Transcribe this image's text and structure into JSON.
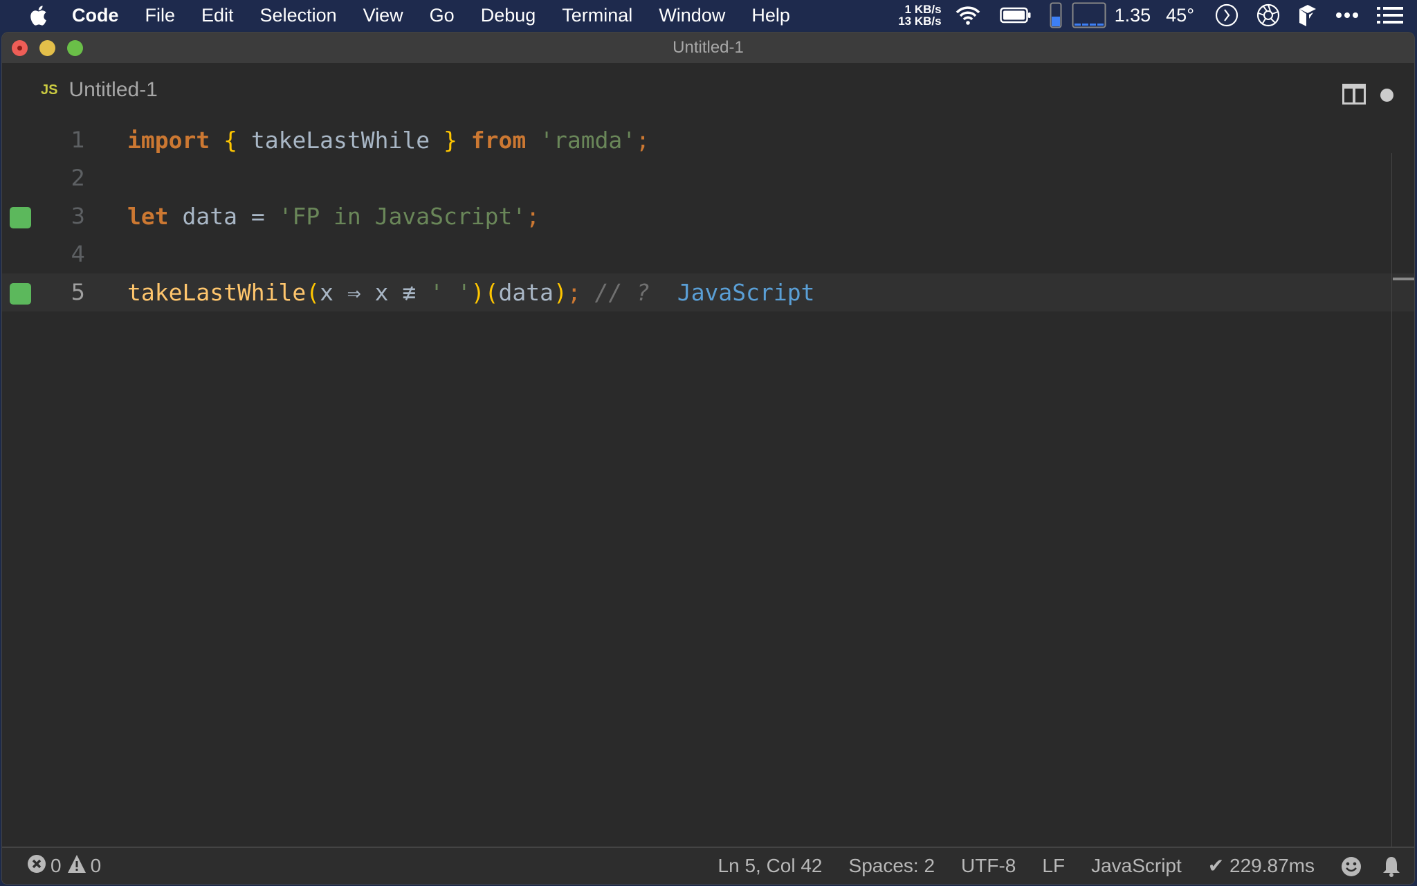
{
  "menubar": {
    "app_name": "Code",
    "items": [
      "File",
      "Edit",
      "Selection",
      "View",
      "Go",
      "Debug",
      "Terminal",
      "Window",
      "Help"
    ],
    "network": {
      "up": "1 KB/s",
      "down": "13 KB/s"
    },
    "load": "1.35",
    "temperature": "45°",
    "icons": [
      "apple-icon",
      "wifi-icon",
      "battery-icon",
      "memory-gauge-icon",
      "cpu-graph-icon",
      "timer-icon",
      "aperture-icon",
      "app-icon",
      "more-icon",
      "list-icon"
    ]
  },
  "window": {
    "title": "Untitled-1"
  },
  "tab": {
    "badge": "JS",
    "name": "Untitled-1",
    "dirty": true
  },
  "editor": {
    "lines": [
      {
        "number": "1",
        "marker": false,
        "current": false
      },
      {
        "number": "2",
        "marker": false,
        "current": false
      },
      {
        "number": "3",
        "marker": true,
        "current": false
      },
      {
        "number": "4",
        "marker": false,
        "current": false
      },
      {
        "number": "5",
        "marker": true,
        "current": true
      }
    ],
    "line1": {
      "import": "import",
      "lbrace": "{",
      "name": " takeLastWhile ",
      "rbrace": "}",
      "from": "from",
      "module": "'ramda'",
      "semi": ";"
    },
    "line3": {
      "let": "let",
      "var": " data ",
      "eq": "=",
      "value": "'FP in JavaScript'",
      "semi": ";"
    },
    "line5": {
      "fn": "takeLastWhile",
      "lp1": "(",
      "param": "x ",
      "arrow": "⇒",
      "x2": " x ",
      "neq": "≢",
      "str": " ' '",
      "rp1": ")",
      "lp2": "(",
      "arg": "data",
      "rp2": ")",
      "semi": ";",
      "comment": " // ? ",
      "result": " JavaScript"
    }
  },
  "statusbar": {
    "errors": "0",
    "warnings": "0",
    "position": "Ln 5, Col 42",
    "indent": "Spaces: 2",
    "encoding": "UTF-8",
    "eol": "LF",
    "language": "JavaScript",
    "timing": "✔ 229.87ms"
  },
  "colors": {
    "marker_green": "#5cb85c",
    "keyword": "#cc7832",
    "string": "#6a8759",
    "function": "#ffc66d",
    "brace": "#ffc600",
    "result": "#5a9fd6"
  }
}
